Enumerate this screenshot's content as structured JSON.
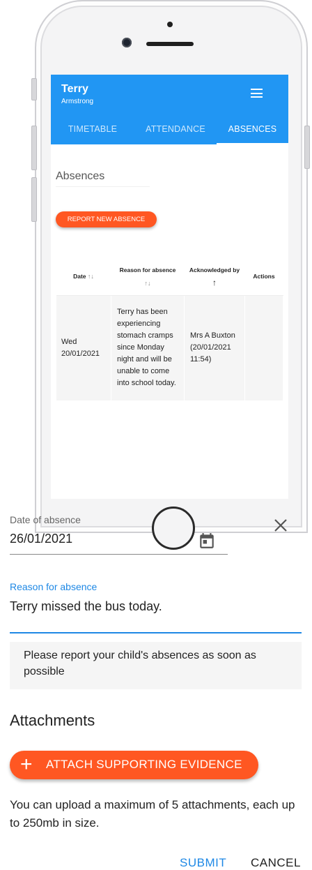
{
  "phone_app": {
    "student_first_name": "Terry",
    "student_last_name": "Armstrong",
    "tabs": [
      {
        "label": "TIMETABLE",
        "active": false
      },
      {
        "label": "ATTENDANCE",
        "active": false
      },
      {
        "label": "ABSENCES",
        "active": true
      }
    ],
    "section_title": "Absences",
    "report_button_label": "REPORT NEW ABSENCE",
    "table": {
      "headers": {
        "date": "Date",
        "reason": "Reason for absence",
        "acknowledged": "Acknowledged by",
        "actions": "Actions"
      },
      "rows": [
        {
          "date": "Wed 20/01/2021",
          "reason": "Terry has been experiencing stomach cramps since Monday night and will be unable to come into school today.",
          "acknowledged": "Mrs A Buxton (20/01/2021 11:54)",
          "actions": ""
        }
      ]
    },
    "accent_color": "#2196f3",
    "button_color": "#ff5722"
  },
  "form": {
    "date_label": "Date of absence",
    "date_value": "26/01/2021",
    "reason_label": "Reason for absence",
    "reason_value": "Terry missed the bus today.",
    "notice": "Please report your child's absences as soon as possible",
    "attachments_title": "Attachments",
    "attach_button_label": "ATTACH SUPPORTING EVIDENCE",
    "upload_note": "You can upload a maximum of 5 attachments, each up to 250mb in size.",
    "submit_label": "SUBMIT",
    "cancel_label": "CANCEL",
    "primary_color": "#1e88e5"
  }
}
